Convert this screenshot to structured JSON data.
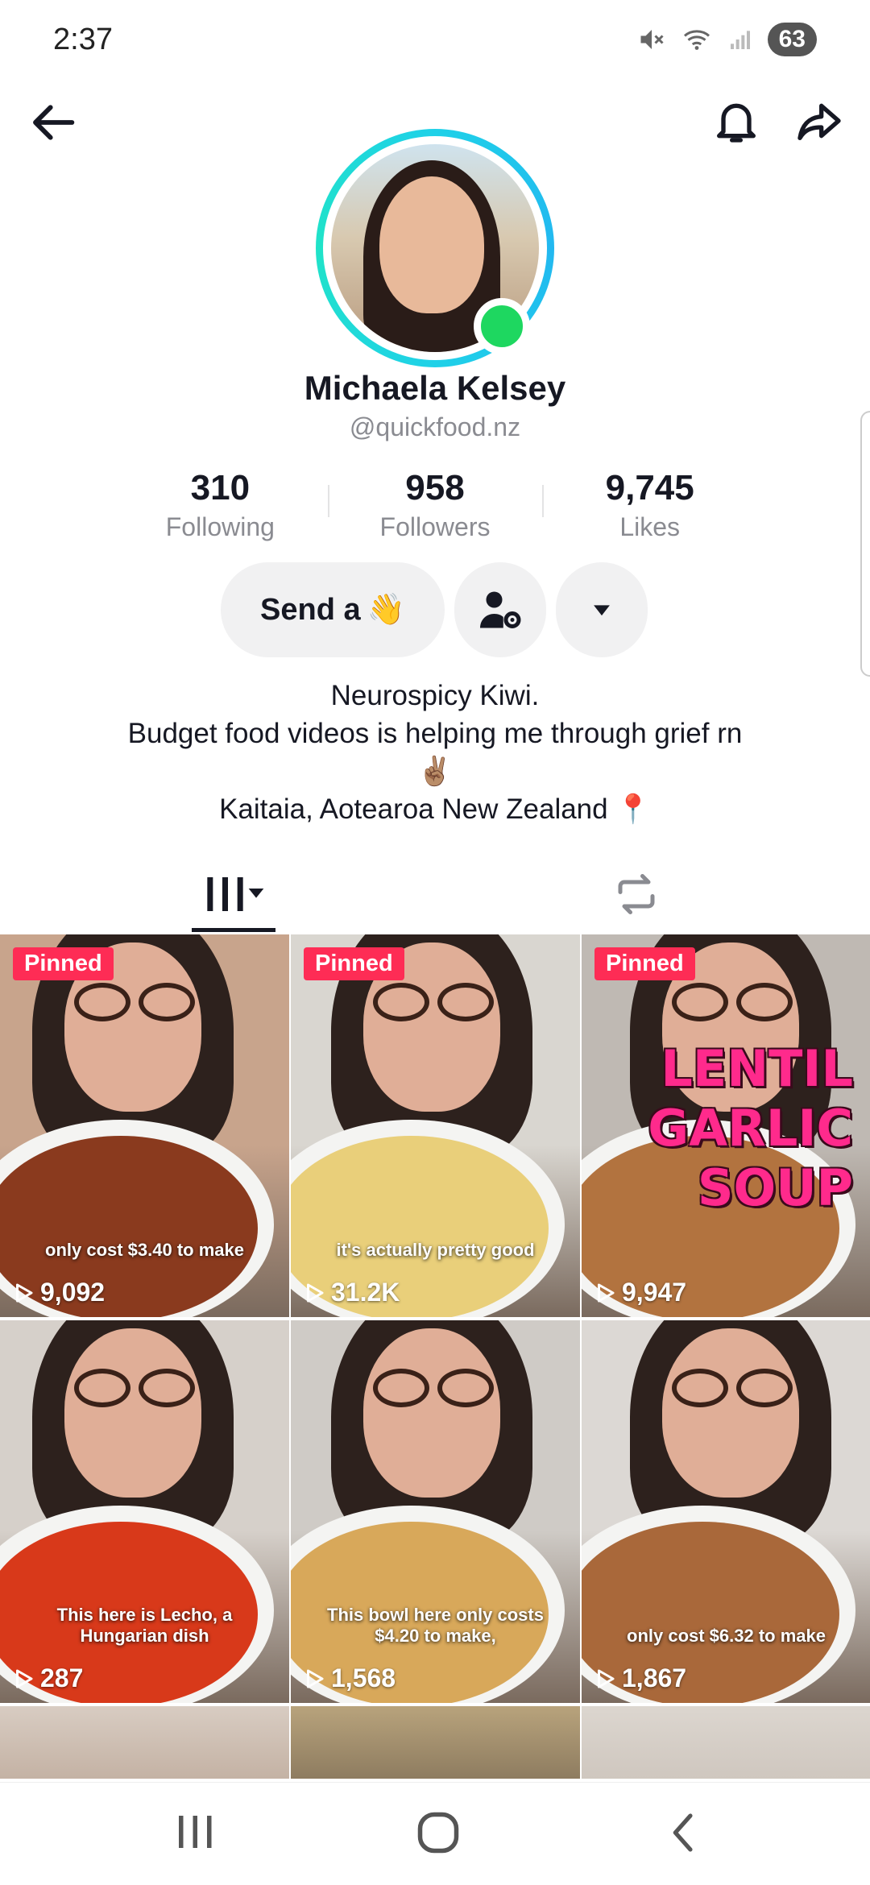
{
  "status_bar": {
    "time": "2:37",
    "battery": "63"
  },
  "profile": {
    "display_name": "Michaela Kelsey",
    "username": "@quickfood.nz"
  },
  "stats": [
    {
      "value": "310",
      "label": "Following"
    },
    {
      "value": "958",
      "label": "Followers"
    },
    {
      "value": "9,745",
      "label": "Likes"
    }
  ],
  "actions": {
    "send_wave_label": "Send a",
    "wave_emoji": "👋"
  },
  "bio": {
    "line1": "Neurospicy Kiwi.",
    "line2": "Budget food videos is helping me through grief rn",
    "line3": "✌🏽",
    "line4": "Kaitaia, Aotearoa New Zealand 📍"
  },
  "videos": [
    {
      "pinned": "Pinned",
      "views": "9,092",
      "caption": "only cost $3.40 to make",
      "bg": "#c8a48c",
      "food": "#8a3a1e"
    },
    {
      "pinned": "Pinned",
      "views": "31.2K",
      "caption": "it's actually pretty good",
      "bg": "#d9d6d0",
      "food": "#e9cf7a"
    },
    {
      "pinned": "Pinned",
      "views": "9,947",
      "caption": "",
      "title": "LENTIL\nGARLIC\nSOUP",
      "bg": "#bfb9b3",
      "food": "#b2733f"
    },
    {
      "pinned": "",
      "views": "287",
      "caption": "This here is Lecho, a Hungarian dish",
      "bg": "#d6d0ca",
      "food": "#d8391a"
    },
    {
      "pinned": "",
      "views": "1,568",
      "caption": "This bowl here only costs $4.20 to make,",
      "bg": "#cfcbc6",
      "food": "#d8a85a"
    },
    {
      "pinned": "",
      "views": "1,867",
      "caption": "only cost $6.32 to make",
      "bg": "#dcd8d4",
      "food": "#a9683a"
    }
  ],
  "colors": {
    "accent": "#fe2c55",
    "online": "#1ed760",
    "ring": "#1fd1e8"
  }
}
